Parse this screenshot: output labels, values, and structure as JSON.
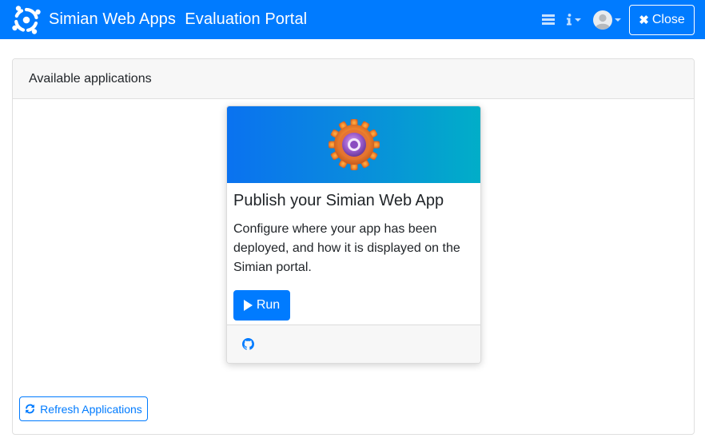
{
  "navbar": {
    "brand_icon": "simian-logo-icon",
    "title": "Simian Web Apps  Evaluation Portal",
    "icons": [
      "list-icon",
      "info-icon",
      "user-avatar-icon"
    ],
    "close_label": "Close",
    "close_icon": "close-icon",
    "background_color": "#007bff"
  },
  "panel": {
    "header": "Available applications"
  },
  "app_card": {
    "image_icon": "gear-icon",
    "title": "Publish your Simian Web App",
    "description": "Configure where your app has been deployed, and how it is displayed on the Simian portal.",
    "run_label": "Run",
    "run_icon": "play-icon",
    "footer_icon": "github-icon"
  },
  "refresh_button": {
    "label": "Refresh Applications",
    "icon": "refresh-icon"
  },
  "colors": {
    "primary": "#007bff",
    "panel_header_bg": "#f7f7f7"
  }
}
